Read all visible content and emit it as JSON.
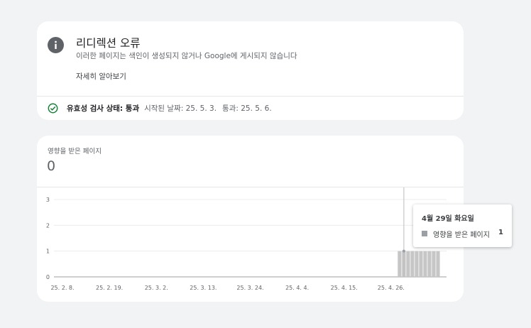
{
  "issue": {
    "title": "리디렉션 오류",
    "description": "이러한 페이지는 색인이 생성되지 않거나 Google에 게시되지 않습니다",
    "learn_more": "자세히 알아보기",
    "status_label": "유효성 검사 상태: 통과",
    "started": "시작된 날짜: 25. 5. 3.",
    "passed": "통과: 25. 5. 6."
  },
  "metric": {
    "label": "영향을 받은 페이지",
    "value": "0"
  },
  "chart_data": {
    "type": "bar",
    "series": [
      {
        "name": "영향을 받은 페이지",
        "points": [
          {
            "x": "2025-04-28",
            "y": 1
          },
          {
            "x": "2025-04-29",
            "y": 1
          },
          {
            "x": "2025-04-30",
            "y": 1
          },
          {
            "x": "2025-05-01",
            "y": 1
          },
          {
            "x": "2025-05-02",
            "y": 1
          },
          {
            "x": "2025-05-03",
            "y": 1
          },
          {
            "x": "2025-05-04",
            "y": 1
          },
          {
            "x": "2025-05-05",
            "y": 1
          },
          {
            "x": "2025-05-06",
            "y": 1
          },
          {
            "x": "2025-05-07",
            "y": 1
          }
        ]
      }
    ],
    "x_range": [
      "2025-02-06",
      "2025-05-09"
    ],
    "x_ticks": [
      {
        "date": "2025-02-08",
        "label": "25. 2. 8."
      },
      {
        "date": "2025-02-19",
        "label": "25. 2. 19."
      },
      {
        "date": "2025-03-02",
        "label": "25. 3. 2."
      },
      {
        "date": "2025-03-13",
        "label": "25. 3. 13."
      },
      {
        "date": "2025-03-24",
        "label": "25. 3. 24."
      },
      {
        "date": "2025-04-04",
        "label": "25. 4. 4."
      },
      {
        "date": "2025-04-15",
        "label": "25. 4. 15."
      },
      {
        "date": "2025-04-26",
        "label": "25. 4. 26."
      }
    ],
    "y_ticks": [
      0,
      1,
      2,
      3
    ],
    "ylim": [
      0,
      3
    ],
    "grid": true,
    "bar_color": "#c6c6c6",
    "hover_date": "2025-04-29"
  },
  "tooltip": {
    "date": "4월 29일 화요일",
    "series": "영향을 받은 페이지",
    "value": "1"
  },
  "colors": {
    "passed_green": "#188038",
    "icon_gray": "#5f6368"
  }
}
